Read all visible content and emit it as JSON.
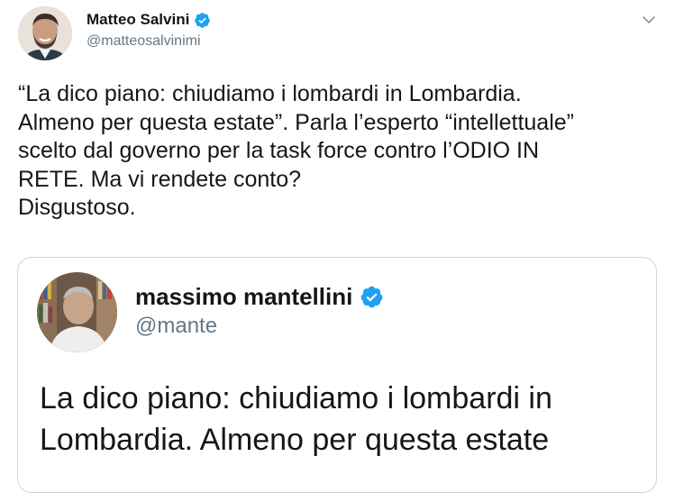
{
  "tweet": {
    "author": {
      "name": "Matteo Salvini",
      "handle": "@matteosalvinimi",
      "verified": true,
      "avatar_icon": "profile-photo"
    },
    "text_lines": [
      "“La dico piano: chiudiamo i lombardi in Lombardia.",
      "Almeno per questa estate”. Parla l’esperto “intellettuale”",
      "scelto dal governo per la task force contro l’ODIO IN",
      "RETE. Ma vi rendete conto?",
      "Disgustoso."
    ],
    "menu_icon": "chevron-down-icon"
  },
  "quoted": {
    "author": {
      "name": "massimo mantellini",
      "handle": "@mante",
      "verified": true,
      "avatar_icon": "profile-photo"
    },
    "text_lines": [
      "La dico piano: chiudiamo i lombardi in",
      "Lombardia. Almeno per questa estate"
    ]
  },
  "colors": {
    "primary_text": "#14171a",
    "secondary_text": "#657786",
    "verified_blue": "#1da1f2",
    "border": "#ccd6dd"
  }
}
